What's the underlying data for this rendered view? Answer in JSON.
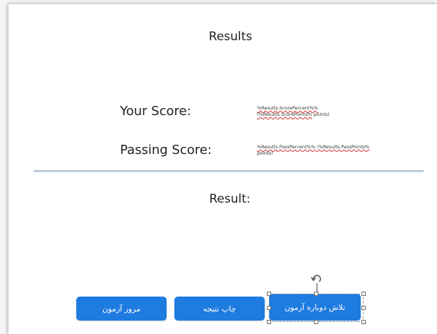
{
  "slide": {
    "title": "Results",
    "your_score_label": "Your Score:",
    "score_var_line1": "%Results.ScorePercent%%",
    "score_var_line2_var": "(%Results.ScorePoints%",
    "score_var_line2_rest": " points)",
    "passing_score_label": "Passing Score:",
    "pass_var_line1_a": "%Results.PassPercent%%",
    "pass_var_line1_b": " (%Results.PassPoints%",
    "pass_var_line2": "points)",
    "result_label": "Result:"
  },
  "buttons": {
    "review": "مرور آزمون",
    "print": "چاپ نتیجه",
    "retry": "تلاش دوباره آزمون"
  },
  "colors": {
    "button": "#1e7be0",
    "divider": "#b4c3d4",
    "spellcheck": "#d23030"
  }
}
